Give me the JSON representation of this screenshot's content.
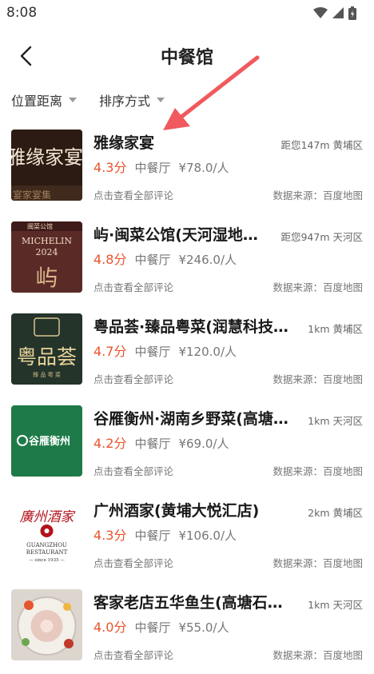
{
  "status": {
    "time": "8:08"
  },
  "header": {
    "title": "中餐馆"
  },
  "filters": [
    {
      "label": "位置距离"
    },
    {
      "label": "排序方式"
    }
  ],
  "colors": {
    "rating": "#e8542d",
    "annotation_arrow": "#f0595d"
  },
  "restaurants": [
    {
      "name": "雅缘家宴",
      "distance": "距您147m 黄埔区",
      "rating": "4.3分",
      "category": "中餐厅",
      "price": "¥78.0/人",
      "reviews": "点击查看全部评论",
      "source": "数据来源：百度地图",
      "thumb_text": "雅缘家宴",
      "thumb_sub": "宴家宴集"
    },
    {
      "name": "屿·闽菜公馆(天河湿地…",
      "distance": "距您947m 天河区",
      "rating": "4.8分",
      "category": "中餐厅",
      "price": "¥246.0/人",
      "reviews": "点击查看全部评论",
      "source": "数据来源：百度地图",
      "thumb_text": "MICHELIN",
      "thumb_sub": "2024",
      "thumb_glyph": "屿",
      "thumb_top": "闽菜公馆"
    },
    {
      "name": "粤品荟·臻品粤菜(润慧科技…",
      "distance": "1km 黄埔区",
      "rating": "4.7分",
      "category": "中餐厅",
      "price": "¥120.0/人",
      "reviews": "点击查看全部评论",
      "source": "数据来源：百度地图",
      "thumb_text": "粤品荟",
      "thumb_sub": "臻 品 粤 菜"
    },
    {
      "name": "谷雁衡州·湖南乡野菜(高塘…",
      "distance": "1km 天河区",
      "rating": "4.2分",
      "category": "中餐厅",
      "price": "¥69.0/人",
      "reviews": "点击查看全部评论",
      "source": "数据来源：百度地图",
      "thumb_text": "谷雁衡州"
    },
    {
      "name": "广州酒家(黄埔大悦汇店)",
      "distance": "2km 黄埔区",
      "rating": "4.3分",
      "category": "中餐厅",
      "price": "¥106.0/人",
      "reviews": "点击查看全部评论",
      "source": "数据来源：百度地图",
      "thumb_text": "廣州酒家",
      "thumb_sub": "GUANGZHOU",
      "thumb_sub2": "RESTAURANT",
      "thumb_since": "— since 1935 —"
    },
    {
      "name": "客家老店五华鱼生(高塘石…",
      "distance": "1km 天河区",
      "rating": "4.0分",
      "category": "中餐厅",
      "price": "¥55.0/人",
      "reviews": "点击查看全部评论",
      "source": "数据来源：百度地图"
    }
  ]
}
